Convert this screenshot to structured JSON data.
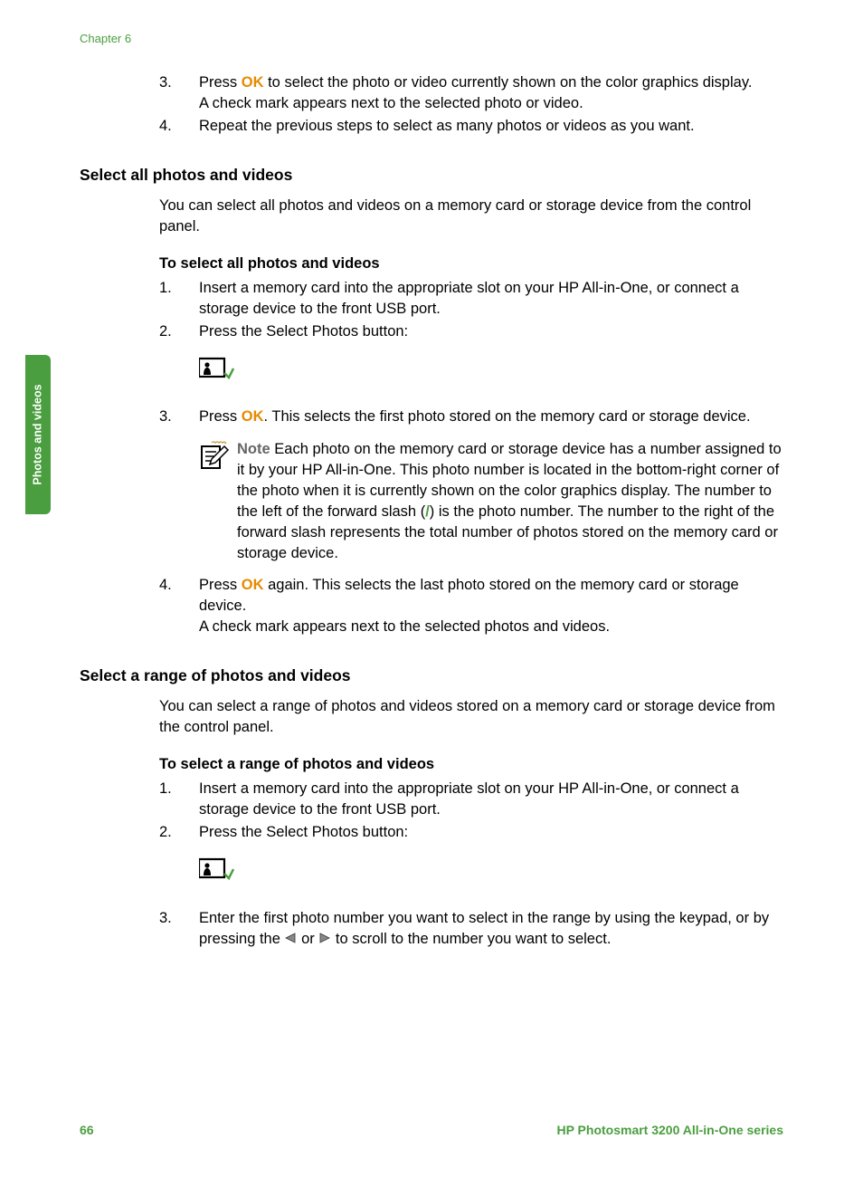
{
  "header": {
    "chapter": "Chapter 6"
  },
  "side_tab": {
    "label": "Photos and videos"
  },
  "top_list": {
    "item3": {
      "num": "3.",
      "prefix": "Press ",
      "ok": "OK",
      "suffix": " to select the photo or video currently shown on the color graphics display.",
      "line2": "A check mark appears next to the selected photo or video."
    },
    "item4": {
      "num": "4.",
      "text": "Repeat the previous steps to select as many photos or videos as you want."
    }
  },
  "select_all": {
    "heading": "Select all photos and videos",
    "intro": "You can select all photos and videos on a memory card or storage device from the control panel.",
    "subheading": "To select all photos and videos",
    "step1": {
      "num": "1.",
      "text": "Insert a memory card into the appropriate slot on your HP All-in-One, or connect a storage device to the front USB port."
    },
    "step2": {
      "num": "2.",
      "text": "Press the Select Photos button:"
    },
    "step3": {
      "num": "3.",
      "prefix": "Press ",
      "ok": "OK",
      "suffix": ". This selects the first photo stored on the memory card or storage device."
    },
    "note": {
      "label": "Note",
      "text_a": "   Each photo on the memory card or storage device has a number assigned to it by your HP All-in-One. This photo number is located in the bottom-right corner of the photo when it is currently shown on the color graphics display. The number to the left of the forward slash (",
      "slash": "/",
      "text_b": ") is the photo number. The number to the right of the forward slash represents the total number of photos stored on the memory card or storage device."
    },
    "step4": {
      "num": "4.",
      "prefix": "Press ",
      "ok": "OK",
      "suffix": " again. This selects the last photo stored on the memory card or storage device.",
      "line2": "A check mark appears next to the selected photos and videos."
    }
  },
  "select_range": {
    "heading": "Select a range of photos and videos",
    "intro": "You can select a range of photos and videos stored on a memory card or storage device from the control panel.",
    "subheading": "To select a range of photos and videos",
    "step1": {
      "num": "1.",
      "text": "Insert a memory card into the appropriate slot on your HP All-in-One, or connect a storage device to the front USB port."
    },
    "step2": {
      "num": "2.",
      "text": "Press the Select Photos button:"
    },
    "step3": {
      "num": "3.",
      "text_a": "Enter the first photo number you want to select in the range by using the keypad, or by pressing the ",
      "text_b": " or ",
      "text_c": " to scroll to the number you want to select."
    }
  },
  "footer": {
    "page": "66",
    "product": "HP Photosmart 3200 All-in-One series"
  }
}
